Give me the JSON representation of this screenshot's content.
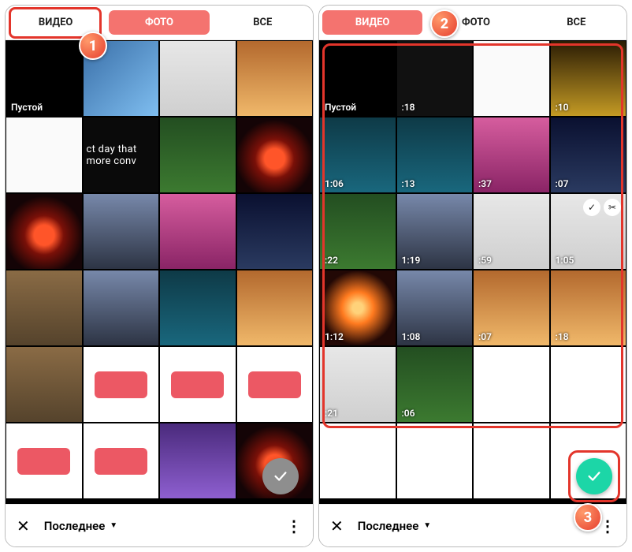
{
  "tabs": {
    "video": "ВИДЕО",
    "photo": "ФОТО",
    "all": "ВСЕ"
  },
  "bottom": {
    "album": "Последнее"
  },
  "left": {
    "empty_label": "Пустой",
    "text_thumb": "ct day that more conv"
  },
  "right": {
    "empty_label": "Пустой",
    "durations": {
      "r0c1": ":18",
      "r0c3": ":10",
      "r1c0": "1:06",
      "r1c1": ":13",
      "r1c2": ":37",
      "r1c3": ":07",
      "r2c0": ":22",
      "r2c1": "1:19",
      "r2c2": ":59",
      "r2c3": "1:05",
      "r3c0": "1:12",
      "r3c1": "1:08",
      "r3c2": ":07",
      "r3c3": ":18",
      "r4c0": ":21",
      "r4c1": ":06"
    }
  },
  "steps": {
    "s1": "1",
    "s2": "2",
    "s3": "3"
  }
}
